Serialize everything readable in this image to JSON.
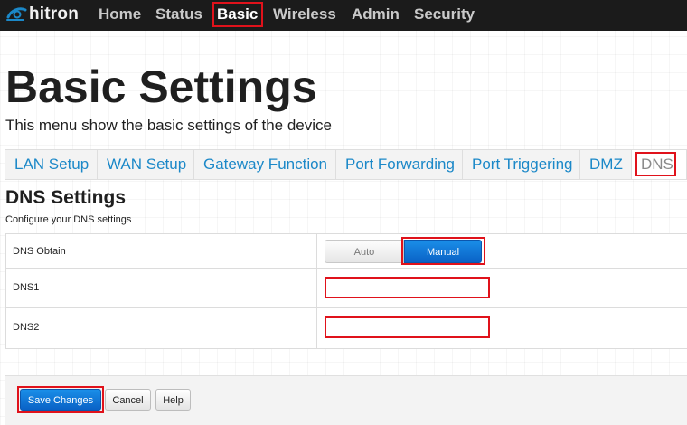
{
  "brand": {
    "logo_text": "hitron",
    "logo_color": "#1b88c8"
  },
  "nav": {
    "items": [
      {
        "label": "Home"
      },
      {
        "label": "Status"
      },
      {
        "label": "Basic"
      },
      {
        "label": "Wireless"
      },
      {
        "label": "Admin"
      },
      {
        "label": "Security"
      }
    ],
    "active": "Basic"
  },
  "page": {
    "title": "Basic Settings",
    "subtitle": "This menu show the basic settings of the device"
  },
  "tabs": {
    "items": [
      {
        "label": "LAN Setup"
      },
      {
        "label": "WAN Setup"
      },
      {
        "label": "Gateway Function"
      },
      {
        "label": "Port Forwarding"
      },
      {
        "label": "Port Triggering"
      },
      {
        "label": "DMZ"
      },
      {
        "label": "DNS"
      }
    ],
    "active": "DNS"
  },
  "section": {
    "title": "DNS Settings",
    "subtitle": "Configure your DNS settings"
  },
  "form": {
    "dns_obtain": {
      "label": "DNS Obtain",
      "options": [
        "Auto",
        "Manual"
      ],
      "selected": "Manual"
    },
    "dns1": {
      "label": "DNS1",
      "value": ""
    },
    "dns2": {
      "label": "DNS2",
      "value": ""
    }
  },
  "actions": {
    "save_label": "Save Changes",
    "cancel_label": "Cancel",
    "help_label": "Help"
  },
  "colors": {
    "accent": "#1b88c8",
    "primary_button": "#0a62c6",
    "highlight": "#e0121b",
    "topbar": "#1b1b1b"
  }
}
